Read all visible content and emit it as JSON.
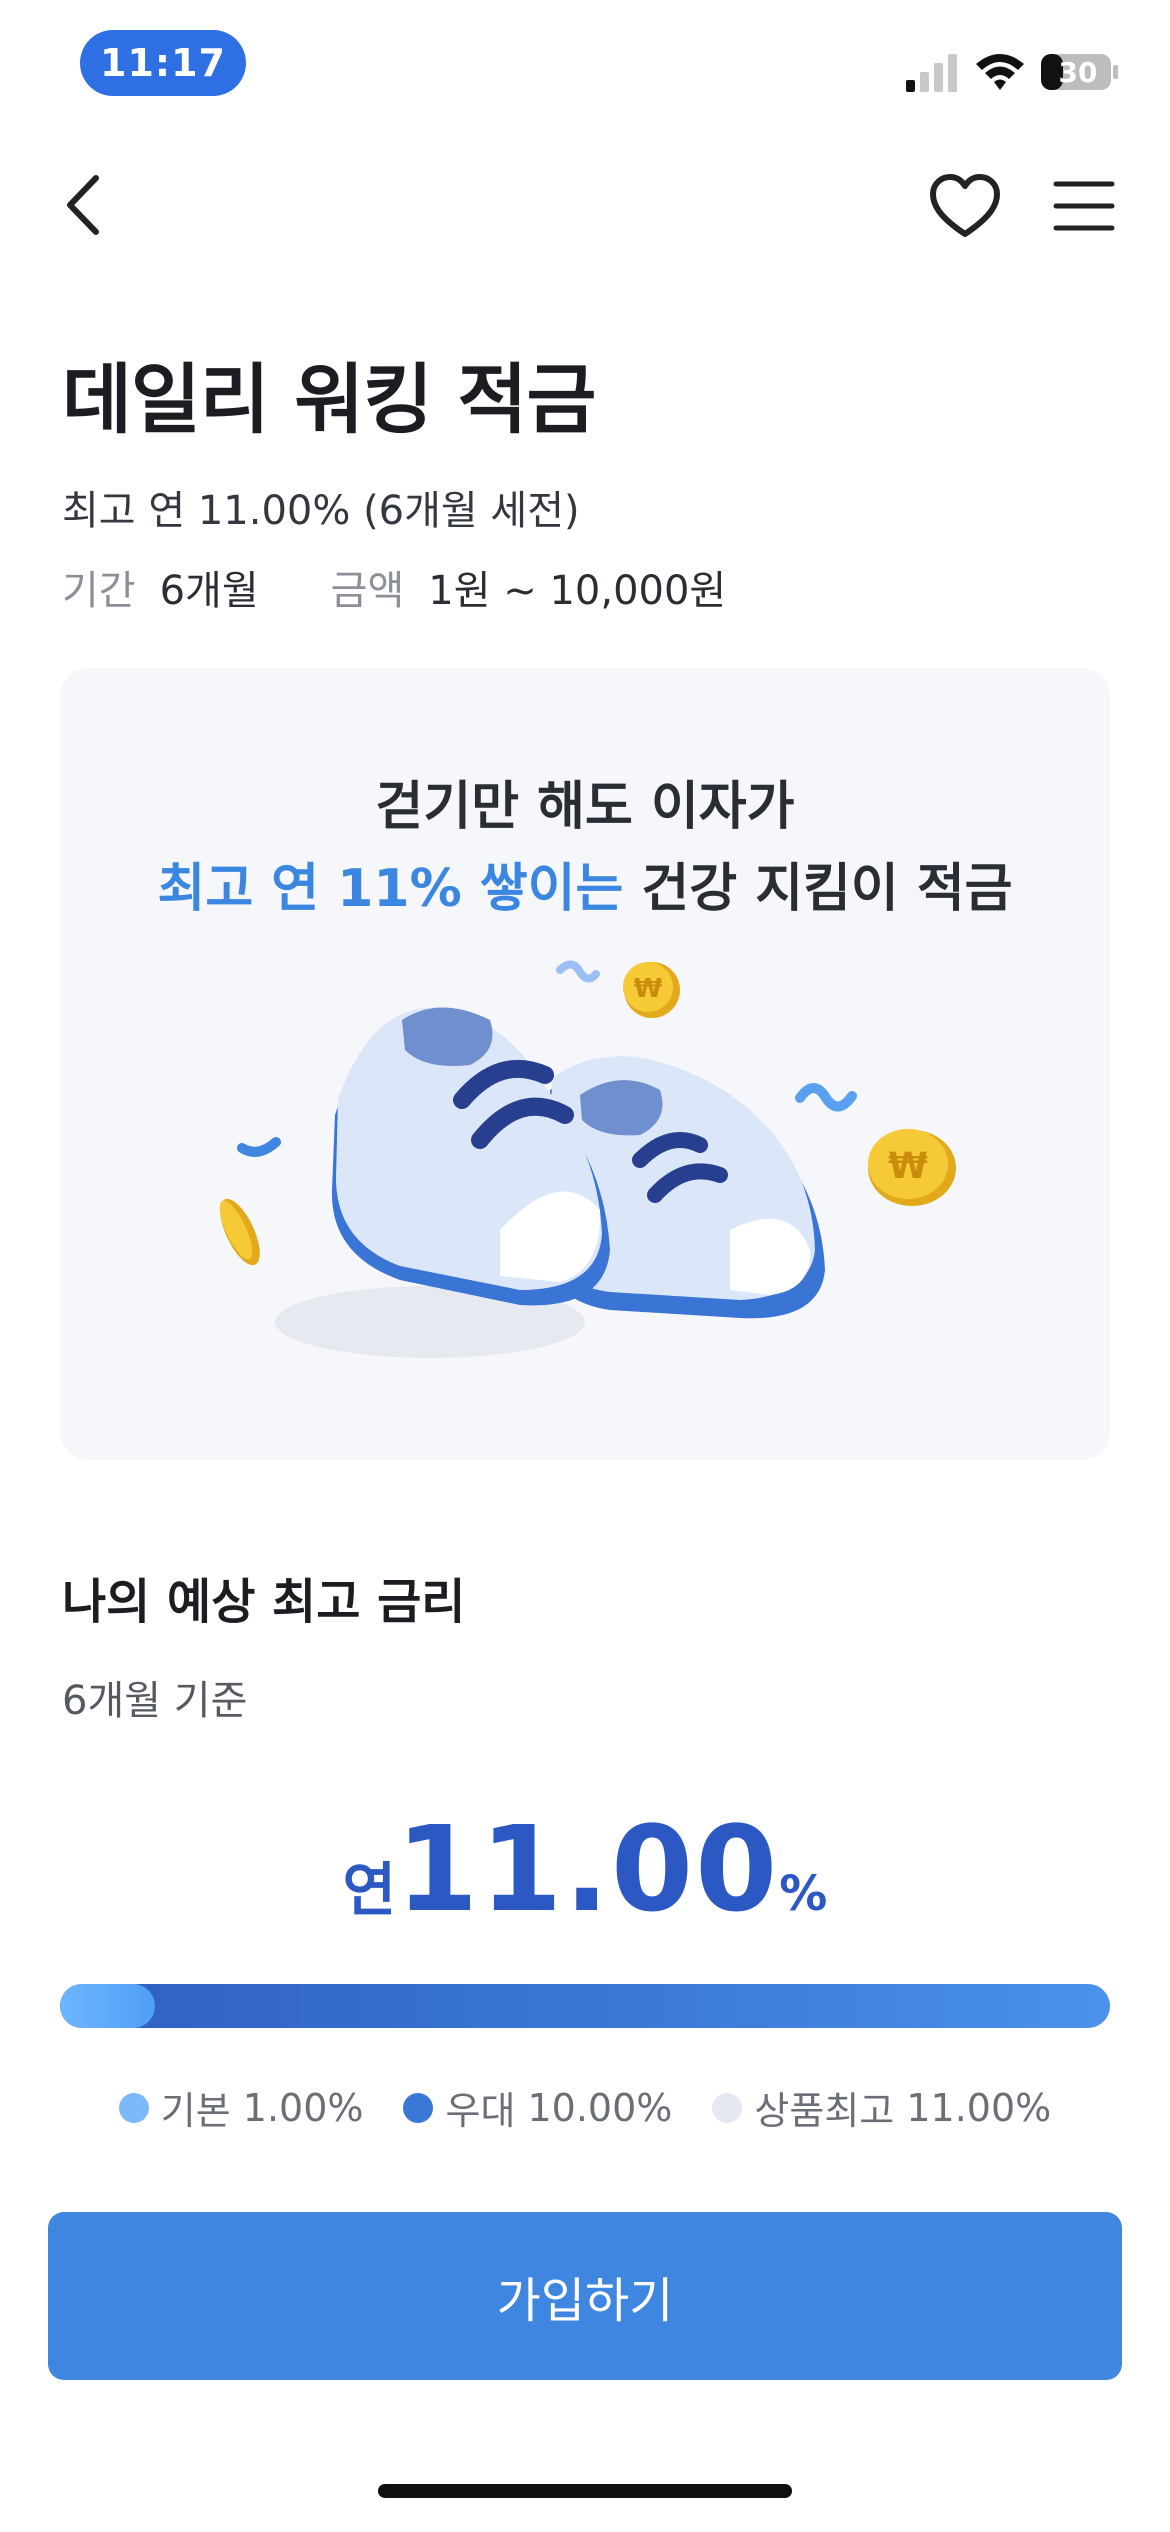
{
  "status_bar": {
    "time": "11:17",
    "battery": "30"
  },
  "nav": {
    "back_icon": "chevron-left-icon",
    "favorite_icon": "heart-outline-icon",
    "menu_icon": "hamburger-menu-icon"
  },
  "product": {
    "title": "데일리 워킹 적금",
    "subtitle": "최고 연 11.00% (6개월 세전)",
    "period_label": "기간",
    "period_value": "6개월",
    "amount_label": "금액",
    "amount_value": "1원 ~ 10,000원"
  },
  "banner": {
    "line1": "걷기만 해도 이자가",
    "line2_highlight": "최고 연 11% 쌓이는",
    "line2_rest": " 건강 지킴이 적금"
  },
  "rate": {
    "section_title": "나의 예상 최고 금리",
    "basis": "6개월 기준",
    "prefix": "연",
    "value": "11.00",
    "unit": "%",
    "base_rate_percent": 1.0,
    "max_rate_percent": 11.0
  },
  "legend": [
    {
      "label": "기본",
      "value": "1.00%",
      "color": "#7db9f8"
    },
    {
      "label": "우대",
      "value": "10.00%",
      "color": "#3a78d8"
    },
    {
      "label": "상품최고",
      "value": "11.00%",
      "color": "#e4e9f1"
    }
  ],
  "colors": {
    "accent": "#3f86e0",
    "rate_text": "#2c58c4",
    "status_pill": "#2f6fe4"
  },
  "join_button": {
    "label": "가입하기"
  }
}
